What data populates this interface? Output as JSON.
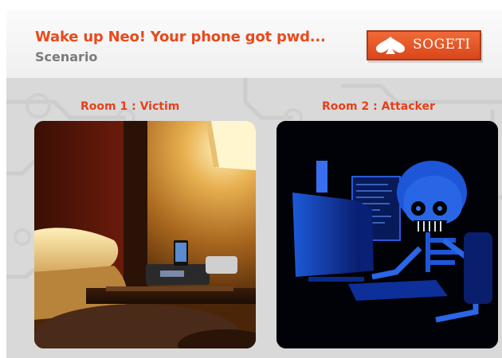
{
  "header": {
    "title": "Wake up Neo! Your phone got pwd...",
    "subtitle": "Scenario"
  },
  "logo": {
    "text": "SOGETI",
    "icon": "spade-icon",
    "color": "#e4521f"
  },
  "rooms": [
    {
      "label": "Room 1 : Victim",
      "image": "hotel-room-photo"
    },
    {
      "label": "Room 2 : Attacker",
      "image": "skeleton-hacker-illustration"
    }
  ],
  "colors": {
    "accent": "#e84a1c",
    "subtitle": "#7a7a7a",
    "background": "#d9d9d9"
  }
}
